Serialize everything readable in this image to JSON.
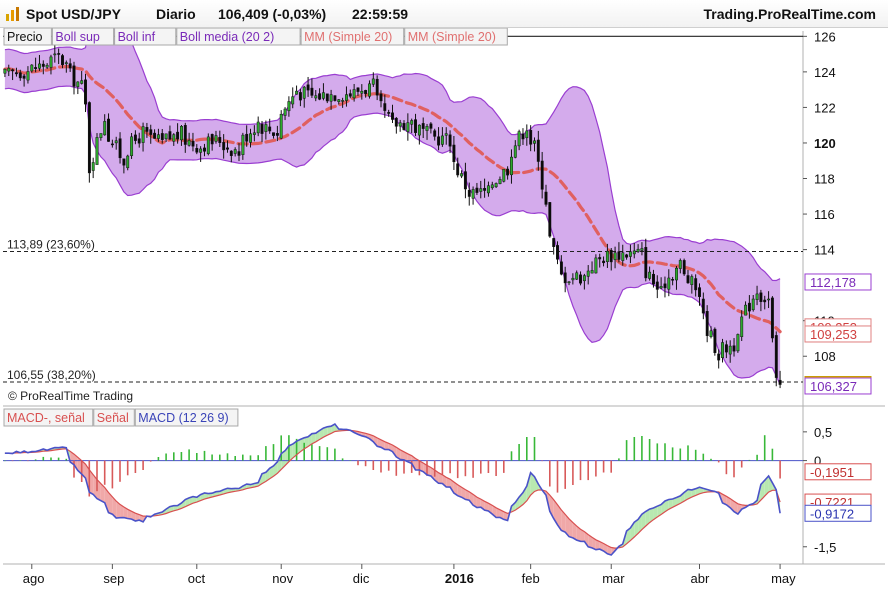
{
  "header": {
    "instrument": "Spot USD/JPY",
    "period": "Diario",
    "price_change": "106,409 (-0,03%)",
    "time": "22:59:59",
    "brand": "Trading.ProRealTime.com"
  },
  "colors": {
    "candle_up": "#2ea82e",
    "candle_down": "#0a0a0a",
    "band_fill": "#c58fe6",
    "band_line": "#9a3ed1",
    "ma_line": "#e06060",
    "macd_line": "#4a52c8",
    "signal_line": "#d85050",
    "hist_pos": "#38b838",
    "hist_neg": "#d85a5a",
    "fill_pos": "#b8e8b0",
    "fill_neg": "#f0a8a8"
  },
  "price_panel": {
    "legend": [
      "Precio",
      "Boll sup",
      "Boll inf",
      "Boll media (20 2)",
      "MM (Simple 20)",
      "MM (Simple 20)"
    ],
    "fib_levels": [
      {
        "value": 113.89,
        "label": "113,89 (23,60%)"
      },
      {
        "value": 106.55,
        "label": "106,55 (38,20%)"
      }
    ],
    "y_ticks": [
      "126",
      "124",
      "122",
      "120",
      "118",
      "116",
      "114",
      "110",
      "108"
    ],
    "y_tick_values": [
      126,
      124,
      122,
      120,
      118,
      116,
      114,
      110,
      108
    ],
    "value_tags": [
      {
        "text": "112,178",
        "value": 112.178,
        "style": "band"
      },
      {
        "text": "109,253",
        "value": 109.253,
        "style": "ma"
      },
      {
        "text": "109,253",
        "value": 109.653,
        "style": "ma"
      },
      {
        "text": "109,253",
        "value": 109.253,
        "style": "ma"
      },
      {
        "text": "106,409",
        "value": 106.409,
        "style": "price"
      },
      {
        "text": "106,327",
        "value": 106.327,
        "style": "band"
      }
    ],
    "watermark": "© ProRealTime Trading"
  },
  "macd_panel": {
    "legend": [
      "MACD-, señal",
      "Señal",
      "MACD (12 26 9)"
    ],
    "y_ticks": [
      "0,5",
      "0",
      "-1,5"
    ],
    "y_tick_values": [
      0.5,
      0,
      -1.5
    ],
    "value_tags": [
      {
        "text": "-0,1951",
        "value": -0.1951,
        "style": "neg"
      },
      {
        "text": "-0,7221",
        "value": -0.7221,
        "style": "neg"
      },
      {
        "text": "-0,9172",
        "value": -0.9172,
        "style": "macd"
      }
    ]
  },
  "x_axis": {
    "labels": [
      "ago",
      "sep",
      "oct",
      "nov",
      "dic",
      "2016",
      "feb",
      "mar",
      "abr",
      "may"
    ]
  },
  "chart_data": {
    "type": "candlestick",
    "title": "Spot USD/JPY",
    "price_ylim": [
      105.2,
      126.3
    ],
    "macd_ylim": [
      -1.8,
      0.95
    ],
    "x_labels": [
      "ago",
      "sep",
      "oct",
      "nov",
      "dic",
      "2016",
      "feb",
      "mar",
      "abr",
      "may"
    ],
    "price_anchors": [
      [
        "2015-07-23",
        123.8
      ],
      [
        "2015-08-03",
        124.2
      ],
      [
        "2015-08-12",
        124.8
      ],
      [
        "2015-08-20",
        123.2
      ],
      [
        "2015-08-24",
        118.6
      ],
      [
        "2015-08-28",
        121.5
      ],
      [
        "2015-09-04",
        119.0
      ],
      [
        "2015-09-11",
        120.6
      ],
      [
        "2015-09-18",
        120.0
      ],
      [
        "2015-09-25",
        120.5
      ],
      [
        "2015-10-02",
        119.8
      ],
      [
        "2015-10-09",
        120.2
      ],
      [
        "2015-10-16",
        119.5
      ],
      [
        "2015-10-23",
        121.2
      ],
      [
        "2015-10-30",
        120.6
      ],
      [
        "2015-11-06",
        123.0
      ],
      [
        "2015-11-13",
        122.6
      ],
      [
        "2015-11-20",
        122.8
      ],
      [
        "2015-11-27",
        122.8
      ],
      [
        "2015-12-04",
        123.2
      ],
      [
        "2015-12-11",
        121.0
      ],
      [
        "2015-12-18",
        121.2
      ],
      [
        "2015-12-25",
        120.4
      ],
      [
        "2016-01-01",
        120.2
      ],
      [
        "2016-01-08",
        117.2
      ],
      [
        "2016-01-15",
        117.2
      ],
      [
        "2016-01-22",
        118.6
      ],
      [
        "2016-01-29",
        121.0
      ],
      [
        "2016-02-02",
        119.8
      ],
      [
        "2016-02-05",
        116.8
      ],
      [
        "2016-02-11",
        112.5
      ],
      [
        "2016-02-19",
        112.5
      ],
      [
        "2016-02-26",
        113.6
      ],
      [
        "2016-03-04",
        113.8
      ],
      [
        "2016-03-11",
        113.8
      ],
      [
        "2016-03-18",
        111.5
      ],
      [
        "2016-03-25",
        113.2
      ],
      [
        "2016-04-01",
        111.6
      ],
      [
        "2016-04-08",
        108.1
      ],
      [
        "2016-04-15",
        108.8
      ],
      [
        "2016-04-22",
        111.8
      ],
      [
        "2016-04-27",
        111.2
      ],
      [
        "2016-04-29",
        106.4
      ],
      [
        "2016-05-02",
        106.4
      ]
    ],
    "macd_anchors": [
      [
        "2015-07-23",
        0.12
      ],
      [
        "2015-08-14",
        0.22
      ],
      [
        "2015-08-24",
        -0.55
      ],
      [
        "2015-09-02",
        -1.0
      ],
      [
        "2015-09-11",
        -1.05
      ],
      [
        "2015-10-02",
        -0.6
      ],
      [
        "2015-10-23",
        -0.4
      ],
      [
        "2015-11-05",
        0.3
      ],
      [
        "2015-11-20",
        0.62
      ],
      [
        "2015-12-02",
        0.4
      ],
      [
        "2015-12-11",
        0.15
      ],
      [
        "2015-12-28",
        -0.35
      ],
      [
        "2016-01-08",
        -0.7
      ],
      [
        "2016-01-22",
        -1.05
      ],
      [
        "2016-02-01",
        -0.2
      ],
      [
        "2016-02-11",
        -1.2
      ],
      [
        "2016-02-22",
        -1.5
      ],
      [
        "2016-03-01",
        -1.65
      ],
      [
        "2016-03-11",
        -0.95
      ],
      [
        "2016-03-25",
        -0.6
      ],
      [
        "2016-04-01",
        -0.45
      ],
      [
        "2016-04-08",
        -0.55
      ],
      [
        "2016-04-15",
        -0.95
      ],
      [
        "2016-04-22",
        -0.7
      ],
      [
        "2016-04-27",
        -0.25
      ],
      [
        "2016-05-02",
        -0.92
      ]
    ],
    "current": {
      "price": 106.409,
      "change_pct": -0.03,
      "boll_upper": 112.178,
      "boll_lower": 106.327,
      "ma20": 109.253,
      "macd": -0.9172,
      "signal": -0.7221,
      "histogram": -0.1951
    }
  }
}
